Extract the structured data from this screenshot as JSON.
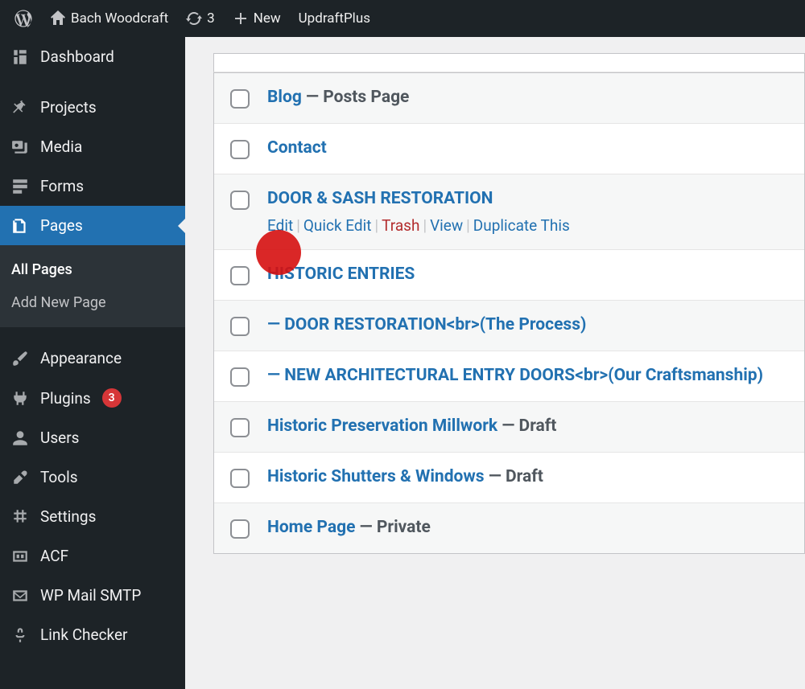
{
  "adminbar": {
    "site_name": "Bach Woodcraft",
    "updates_count": "3",
    "new_label": "New",
    "updraft_label": "UpdraftPlus"
  },
  "sidebar": {
    "items": [
      {
        "label": "Dashboard",
        "icon": "dashboard"
      },
      {
        "label": "Projects",
        "icon": "pin"
      },
      {
        "label": "Media",
        "icon": "media"
      },
      {
        "label": "Forms",
        "icon": "forms"
      },
      {
        "label": "Pages",
        "icon": "pages",
        "current": true
      },
      {
        "label": "Appearance",
        "icon": "brush"
      },
      {
        "label": "Plugins",
        "icon": "plug",
        "badge": "3"
      },
      {
        "label": "Users",
        "icon": "user"
      },
      {
        "label": "Tools",
        "icon": "wrench"
      },
      {
        "label": "Settings",
        "icon": "settings"
      },
      {
        "label": "ACF",
        "icon": "acf"
      },
      {
        "label": "WP Mail SMTP",
        "icon": "mail"
      },
      {
        "label": "Link Checker",
        "icon": "link"
      }
    ],
    "submenu": {
      "all_pages": "All Pages",
      "add_new": "Add New Page"
    }
  },
  "pages": [
    {
      "title": "Blog",
      "suffix": " — Posts Page",
      "alt": true
    },
    {
      "title": "Contact"
    },
    {
      "title": "DOOR & SASH RESTORATION",
      "alt": true,
      "actions": true
    },
    {
      "title": "HISTORIC ENTRIES"
    },
    {
      "title": "— DOOR RESTORATION<br>(The Process)",
      "alt": true
    },
    {
      "title": "— NEW ARCHITECTURAL ENTRY DOORS<br>(Our Craftsmanship)"
    },
    {
      "title": "Historic Preservation Millwork",
      "suffix": " — Draft",
      "alt": true
    },
    {
      "title": "Historic Shutters & Windows",
      "suffix": " — Draft"
    },
    {
      "title": "Home Page",
      "suffix": " — Private",
      "alt": true
    }
  ],
  "row_actions": {
    "edit": "Edit",
    "quick_edit": "Quick Edit",
    "trash": "Trash",
    "view": "View",
    "duplicate": "Duplicate This"
  }
}
